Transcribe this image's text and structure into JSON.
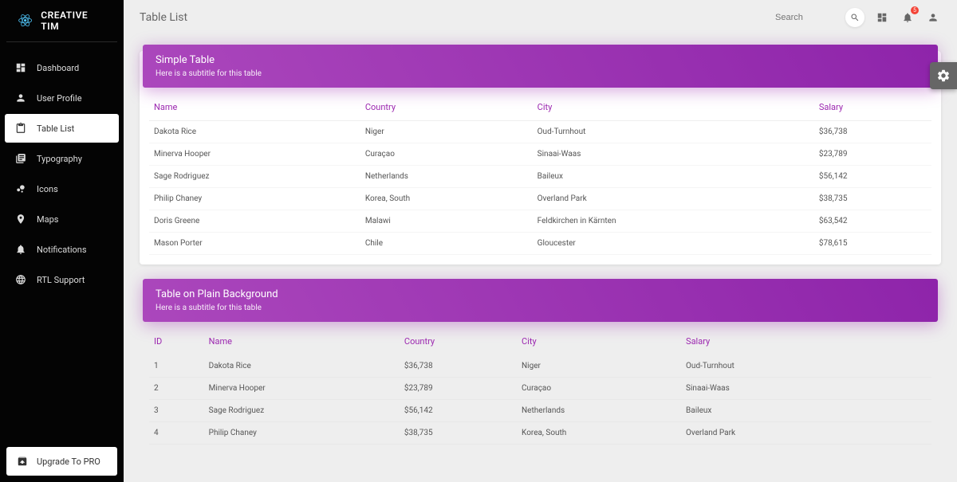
{
  "brand": {
    "title": "CREATIVE TIM"
  },
  "sidebar": {
    "items": [
      {
        "label": "Dashboard"
      },
      {
        "label": "User Profile"
      },
      {
        "label": "Table List"
      },
      {
        "label": "Typography"
      },
      {
        "label": "Icons"
      },
      {
        "label": "Maps"
      },
      {
        "label": "Notifications"
      },
      {
        "label": "RTL Support"
      }
    ],
    "upgrade": "Upgrade To PRO"
  },
  "topbar": {
    "title": "Table List",
    "search_placeholder": "Search",
    "notification_count": "5"
  },
  "card1": {
    "title": "Simple Table",
    "subtitle": "Here is a subtitle for this table",
    "columns": [
      "Name",
      "Country",
      "City",
      "Salary"
    ],
    "rows": [
      [
        "Dakota Rice",
        "Niger",
        "Oud-Turnhout",
        "$36,738"
      ],
      [
        "Minerva Hooper",
        "Curaçao",
        "Sinaai-Waas",
        "$23,789"
      ],
      [
        "Sage Rodriguez",
        "Netherlands",
        "Baileux",
        "$56,142"
      ],
      [
        "Philip Chaney",
        "Korea, South",
        "Overland Park",
        "$38,735"
      ],
      [
        "Doris Greene",
        "Malawi",
        "Feldkirchen in Kärnten",
        "$63,542"
      ],
      [
        "Mason Porter",
        "Chile",
        "Gloucester",
        "$78,615"
      ]
    ]
  },
  "card2": {
    "title": "Table on Plain Background",
    "subtitle": "Here is a subtitle for this table",
    "columns": [
      "ID",
      "Name",
      "Country",
      "City",
      "Salary"
    ],
    "rows": [
      [
        "1",
        "Dakota Rice",
        "$36,738",
        "Niger",
        "Oud-Turnhout"
      ],
      [
        "2",
        "Minerva Hooper",
        "$23,789",
        "Curaçao",
        "Sinaai-Waas"
      ],
      [
        "3",
        "Sage Rodriguez",
        "$56,142",
        "Netherlands",
        "Baileux"
      ],
      [
        "4",
        "Philip Chaney",
        "$38,735",
        "Korea, South",
        "Overland Park"
      ]
    ]
  }
}
